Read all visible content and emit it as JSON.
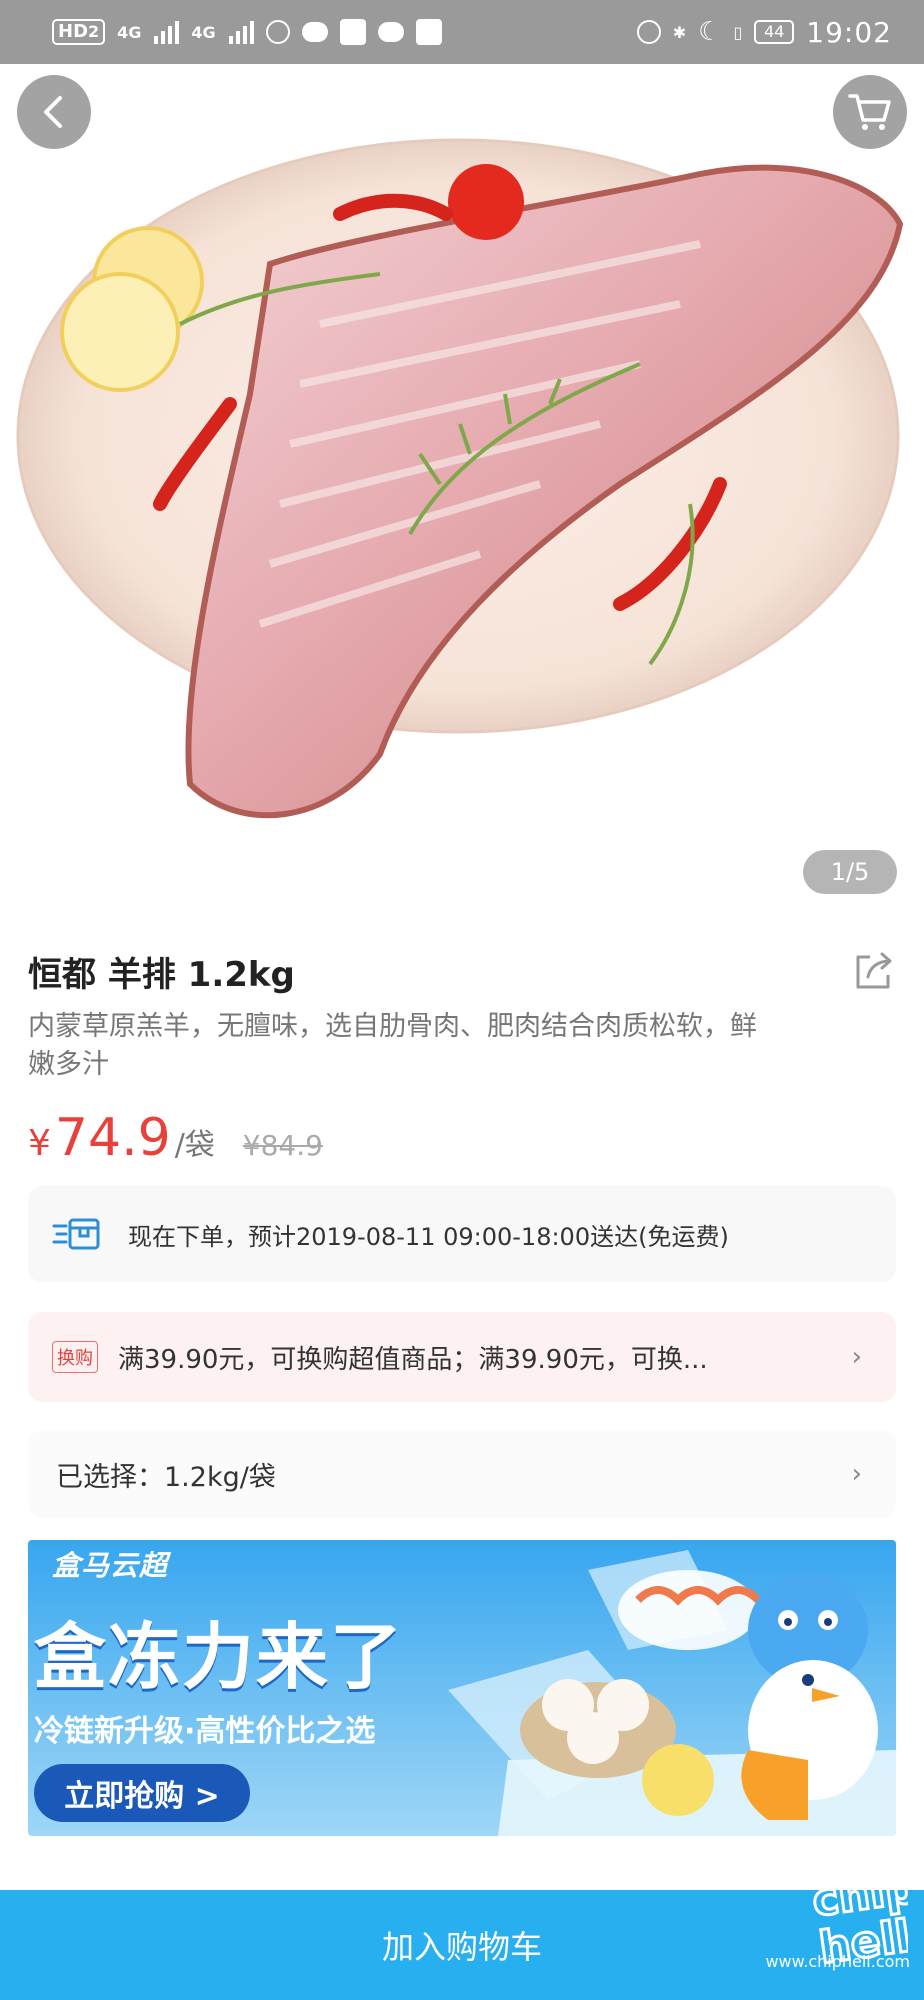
{
  "status_bar": {
    "hd_label": "HD",
    "sim_slot": "2",
    "signal1_label": "4G",
    "signal2_label": "4G",
    "battery": "44",
    "time": "19:02"
  },
  "hero": {
    "page_indicator": "1/5"
  },
  "product": {
    "title": "恒都 羊排 1.2kg",
    "subtitle": "内蒙草原羔羊，无膻味，选自肋骨肉、肥肉结合肉质松软，鲜嫩多汁",
    "price_symbol": "¥",
    "price": "74.9",
    "unit": "/袋",
    "original_price": "¥84.9"
  },
  "delivery": {
    "text": "现在下单，预计2019-08-11 09:00-18:00送达(免运费)"
  },
  "promotion": {
    "tag": "换购",
    "text": "满39.90元，可换购超值商品；满39.90元，可换..."
  },
  "selection": {
    "text": "已选择：1.2kg/袋"
  },
  "banner": {
    "brand": "盒马云超",
    "headline": "盒冻力来了",
    "tagline": "冷链新升级·高性价比之选",
    "cta": "立即抢购 >"
  },
  "footer": {
    "add_to_cart": "加入购物车"
  },
  "watermark": {
    "logo": "chiphell",
    "url": "www.chiphell.com"
  },
  "colors": {
    "accent_blue": "#27aff0",
    "price_red": "#e8413b"
  }
}
